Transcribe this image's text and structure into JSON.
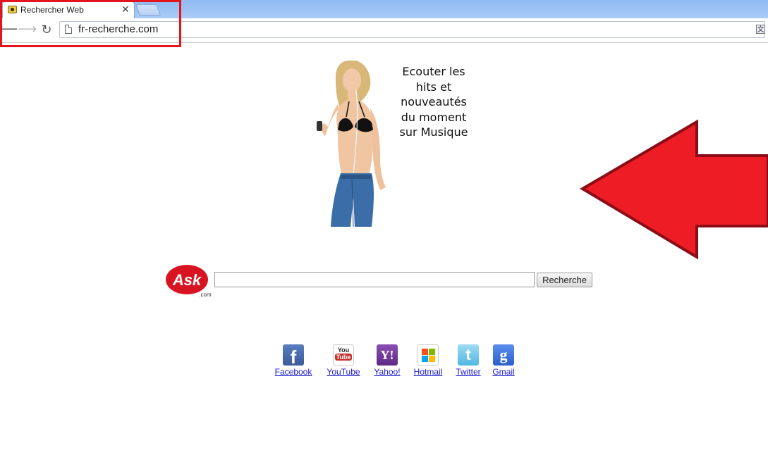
{
  "browser": {
    "tab": {
      "title": "Rechercher Web",
      "close_symbol": "✕",
      "favicon": "camera-favicon-icon"
    },
    "toolbar": {
      "back_symbol": "⟵",
      "forward_symbol": "⟶",
      "reload_symbol": "↻",
      "url": "fr-recherche.com",
      "translate_symbol": "文"
    },
    "highlight_color": "#e3141c"
  },
  "advert": {
    "image": "woman-listening-music-image",
    "lines": [
      "Ecouter les",
      "hits et",
      "nouveautés",
      "du moment",
      "sur Musique"
    ]
  },
  "annotation": {
    "arrow_color": "#ee1c25",
    "arrow_outline": "#8b0c16",
    "arrow_direction": "left"
  },
  "search": {
    "logo_text": "Ask",
    "logo_suffix": ".com",
    "logo_color": "#d91422",
    "input_value": "",
    "button_label": "Recherche"
  },
  "quick_links": [
    {
      "label": "Facebook",
      "icon": "facebook-icon",
      "glyph": "f"
    },
    {
      "label": "YouTube",
      "icon": "youtube-icon",
      "glyph_top": "You",
      "glyph_bottom": "Tube"
    },
    {
      "label": "Yahoo!",
      "icon": "yahoo-icon",
      "glyph": "Y!"
    },
    {
      "label": "Hotmail",
      "icon": "windows-icon"
    },
    {
      "label": "Twitter",
      "icon": "twitter-icon",
      "glyph": "t"
    },
    {
      "label": "Gmail",
      "icon": "google-icon",
      "glyph": "g"
    }
  ]
}
